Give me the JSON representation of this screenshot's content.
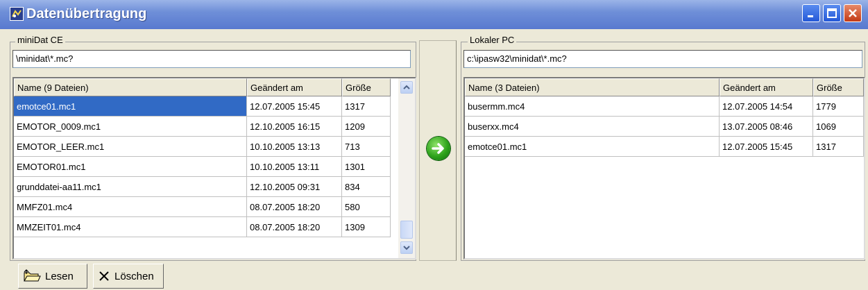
{
  "window": {
    "title": "Datenübertragung",
    "icons": {
      "app": "app-icon",
      "minimize": "minimize-icon",
      "maximize": "maximize-icon",
      "close": "close-icon"
    }
  },
  "left": {
    "group_label": "miniDat CE",
    "path": "\\minidat\\*.mc?",
    "columns": [
      "Name    (9 Dateien)",
      "Geändert am",
      "Größe"
    ],
    "rows": [
      [
        "emotce01.mc1",
        "12.07.2005 15:45",
        "1317"
      ],
      [
        "EMOTOR_0009.mc1",
        "12.10.2005 16:15",
        "1209"
      ],
      [
        "EMOTOR_LEER.mc1",
        "10.10.2005 13:13",
        "713"
      ],
      [
        "EMOTOR01.mc1",
        "10.10.2005 13:11",
        "1301"
      ],
      [
        "grunddatei-aa11.mc1",
        "12.10.2005 09:31",
        "834"
      ],
      [
        "MMFZ01.mc4",
        "08.07.2005 18:20",
        "580"
      ],
      [
        "MMZEIT01.mc4",
        "08.07.2005 18:20",
        "1309"
      ]
    ],
    "selected_row": 0
  },
  "right": {
    "group_label": "Lokaler PC",
    "path": "c:\\ipasw32\\minidat\\*.mc?",
    "columns": [
      "Name    (3 Dateien)",
      "Geändert am",
      "Größe"
    ],
    "rows": [
      [
        "busermm.mc4",
        "12.07.2005 14:54",
        "1779"
      ],
      [
        "buserxx.mc4",
        "13.07.2005 08:46",
        "1069"
      ],
      [
        "emotce01.mc1",
        "12.07.2005 15:45",
        "1317"
      ]
    ]
  },
  "transfer": {
    "icon": "arrow-right-icon"
  },
  "toolbar": {
    "read_label": "Lesen",
    "read_icon": "folder-open-icon",
    "delete_label": "Löschen",
    "delete_icon": "x-delete-icon"
  },
  "colors": {
    "titlebar": "#6f8fd8",
    "selection": "#316ac5",
    "window_bg": "#ece9d8"
  }
}
